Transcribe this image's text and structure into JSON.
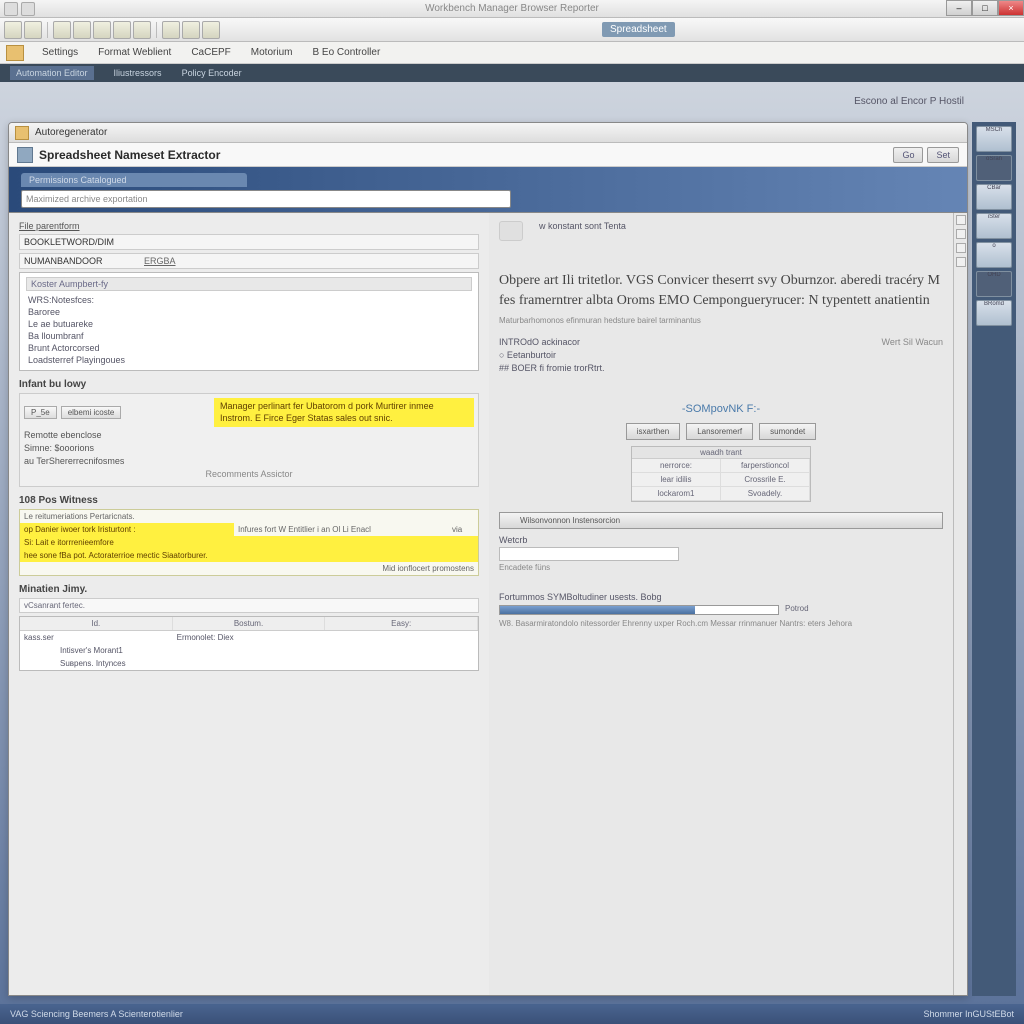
{
  "chrome": {
    "title": "Workbench Manager Browser Reporter",
    "tab_label": "Spreadsheet"
  },
  "menubar": {
    "items": [
      "Settings",
      "Format Weblient",
      "CaCEPF",
      "Motorium",
      "B Eo Controller"
    ]
  },
  "subnav": {
    "items": [
      "Automation Editor",
      "Iliustressors",
      "Policy Encoder"
    ]
  },
  "inner": {
    "tab_title": "Autoregenerator",
    "header_title": "Spreadsheet Nameset Extractor",
    "btn1": "Go",
    "btn2": "Set",
    "corner": "Escono al Encor P Hostil"
  },
  "banner": {
    "tab": "Permissions Catalogued",
    "search_placeholder": "Maximized archive exportation"
  },
  "left": {
    "top_label": "File parentform",
    "field1_label": "BOOKLETWORD/DIM",
    "field1_val": "",
    "field2_label": "NUMANBANDOOR",
    "field2_val": "ERGBA",
    "listhead": "Koster Aumpbert-fy",
    "listitems": [
      "WRS:Notesfces:",
      "Baroree",
      "Le ae butuareke",
      "Ba lloumbranf",
      "Brunt Actorcorsed",
      "Loadsterref Playingoues"
    ],
    "sec2_title": "Infant bu lowy",
    "sec2_btn1": "P_5e",
    "sec2_btn2": "elbemi icoste",
    "sec2_line1": "Remotte ebenclose",
    "sec2_line2": "Simne: $ooorions",
    "sec2_line3": "au TerShererrecnifosmes",
    "sec2_note": "Recomments Assictor",
    "hl_line1": "Manager perlinart fer Ubatorom d pork Murtirer inmee",
    "hl_line2": "Instrom. E Firce  Eger Statas sales out snic.",
    "sec3_title": "108 Pos Witness",
    "sec3_head": "Le reitumeriations Pertaricnats.",
    "sec3_r1c1": "op Danier iwoer tork  Iristurtont :",
    "sec3_r1c2": "Infures  fort W Entitlier  i  an Ol Li Enacl",
    "sec3_r1c3": "via",
    "sec3_r2": "Si: Lait e itorrrenieemfore",
    "sec3_r3": "hee sone  fBa pot. Actoraterrioe mectic   Siaatorburer.",
    "sec3_r4": "Mid ionflocert promostens",
    "sec4_title": "Minatien Jimy.",
    "sec4_head": "vCsanrant fertec.",
    "tbl_h1": "Id.",
    "tbl_h2": "Bostum.",
    "tbl_h3": "Easy:",
    "tbl_r1c1": "kass.ser",
    "tbl_r1c2": "Ermonolet: Diex",
    "tbl_r2": "Intisver's Morant1",
    "tbl_r3": "Suврens. Intynces"
  },
  "right": {
    "head": "w konstant sont Tenta",
    "headline": "Obpere art Ili tritetlor. VGS Convicer theserrt svy Oburnzor. aberedi tracéry M fes framerntrer albta Oroms EMO Cempongueryrucer: N typentett anatientin",
    "subhead": "Maturbarhomonos efinmuran hedsture bairel tarminantus",
    "kv1_k": "INTROdO ackinacor",
    "kv1_v": "",
    "kv1_r": "Wert Sil Wacun",
    "kv2_k": "○ Eetanburtoir",
    "kv3_k": "## BOER fi fromie trorRtrt.",
    "link_title": "-SOMpovNK F:-",
    "rbtn1": "isxarthen",
    "rbtn2": "Lansoremerf",
    "rbtn3": "sumondet",
    "mhead": "waadh trant",
    "m1a": "nerrorce:",
    "m1b": "farperstioncol",
    "m2a": "lear idilis",
    "m2b": "Crossrile E.",
    "m3a": "lockarom1",
    "m3b": "Svoadely.",
    "widebtn": "Wilsonvonnon Instensorcion",
    "field_label": "Wetcrb",
    "input_note": "Encadete füns",
    "prog_label": "Fortummos SYMBoltudiner usests. Bobg",
    "prog_val": "Potrod",
    "prog_note": "W8. Basarmiratondolo nitessorder Ehrenny uxper Roch.cm Messar rrinmanuer Nantrs: eters Jehora"
  },
  "sidebar_icons": [
    "MSCh",
    "oSran",
    "CBar",
    "iSter",
    "o",
    "OHD",
    "BRomd"
  ],
  "status": {
    "left": "VAG Sciencing Beemers A Scienterotienlier",
    "right": "Shommer InGUStEBot"
  }
}
